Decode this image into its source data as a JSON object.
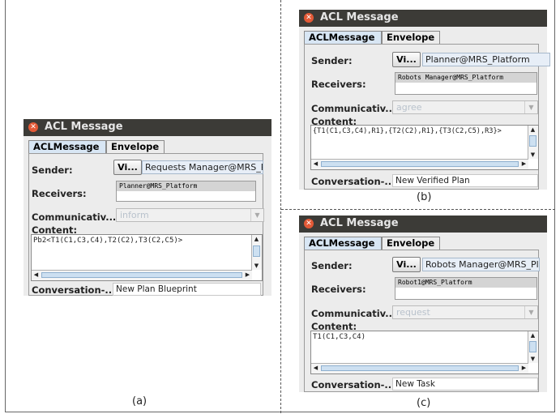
{
  "captions": {
    "a": "(a)",
    "b": "(b)",
    "c": "(c)"
  },
  "common": {
    "window_title": "ACL Message",
    "tab_aclmessage": "ACLMessage",
    "tab_envelope": "Envelope",
    "sender_label": "Sender:",
    "view_button": "Vi...",
    "receivers_label": "Receivers:",
    "communicative_label": "Communicativ...",
    "content_label": "Content:",
    "conversation_label": "Conversation-..."
  },
  "windows": {
    "a": {
      "sender": "Requests Manager@MRS_P",
      "receiver": "Planner@MRS_Platform",
      "performative": "inform",
      "content": "Pb2<T1(C1,C3,C4),T2(C2),T3(C2,C5)>",
      "conversation": "New Plan Blueprint"
    },
    "b": {
      "sender": "Planner@MRS_Platform",
      "receiver": "Robots Manager@MRS_Platform",
      "performative": "agree",
      "content": "{T1(C1,C3,C4),R1},{T2(C2),R1},{T3(C2,C5),R3}>",
      "conversation": "New Verified Plan"
    },
    "c": {
      "sender": "Robots Manager@MRS_Pla",
      "receiver": "Robot1@MRS_Platform",
      "performative": "request",
      "content": "T1(C1,C3,C4)",
      "conversation": "New Task"
    }
  },
  "icons": {
    "close": "close-icon",
    "scroll_up": "arrow-up-icon",
    "scroll_down": "arrow-down-icon",
    "scroll_left": "arrow-left-icon",
    "scroll_right": "arrow-right-icon"
  },
  "colors": {
    "titlebar": "#3c3b37",
    "close": "#e35936",
    "active_tab": "#d8e6f4"
  }
}
